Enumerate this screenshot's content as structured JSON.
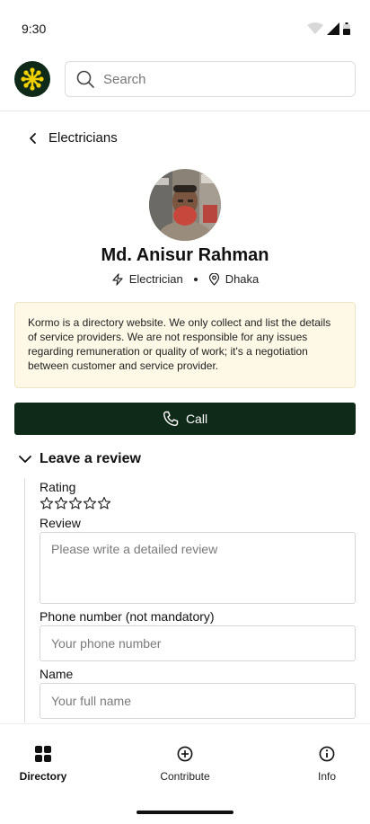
{
  "status_bar": {
    "time": "9:30"
  },
  "header": {
    "search_placeholder": "Search"
  },
  "breadcrumb": {
    "label": "Electricians"
  },
  "profile": {
    "name": "Md. Anisur Rahman",
    "profession": "Electrician",
    "location": "Dhaka"
  },
  "notice": {
    "text": "Kormo is a directory website. We only collect and list the details of service providers. We are not responsible for any issues regarding remuneration or quality of work; it's a negotiation between customer and service provider."
  },
  "call_button": {
    "label": "Call"
  },
  "review": {
    "title": "Leave a review",
    "rating_label": "Rating",
    "rating_value": 0,
    "rating_max": 5,
    "review_label": "Review",
    "review_placeholder": "Please write a detailed review",
    "phone_label": "Phone number (not mandatory)",
    "phone_placeholder": "Your phone number",
    "name_label": "Name",
    "name_placeholder": "Your full name"
  },
  "bottom_nav": {
    "items": [
      {
        "label": "Directory",
        "icon": "grid-icon",
        "active": true
      },
      {
        "label": "Contribute",
        "icon": "plus-circle-icon",
        "active": false
      },
      {
        "label": "Info",
        "icon": "info-circle-icon",
        "active": false
      }
    ]
  },
  "colors": {
    "brand_dark": "#0f2a18",
    "brand_accent": "#f2d000",
    "notice_bg": "#fdf9e6"
  }
}
